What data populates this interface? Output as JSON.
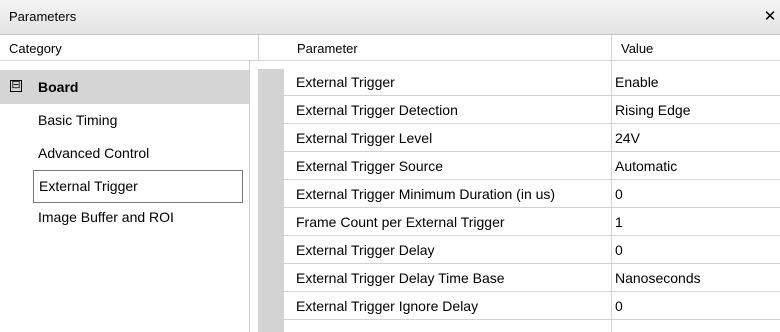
{
  "window": {
    "title": "Parameters",
    "close_glyph": "✕"
  },
  "headers": {
    "category": "Category",
    "parameter": "Parameter",
    "value": "Value"
  },
  "categories": {
    "board": {
      "label": "Board",
      "expander": "⊟"
    },
    "items": [
      "Basic Timing",
      "Advanced Control",
      "External Trigger",
      "Image Buffer and ROI"
    ],
    "selected": "External Trigger"
  },
  "params": [
    {
      "name": "External Trigger",
      "value": "Enable"
    },
    {
      "name": "External Trigger Detection",
      "value": "Rising Edge"
    },
    {
      "name": "External Trigger Level",
      "value": "24V"
    },
    {
      "name": "External Trigger Source",
      "value": "Automatic"
    },
    {
      "name": "External Trigger Minimum Duration (in us)",
      "value": "0"
    },
    {
      "name": "Frame Count per External Trigger",
      "value": "1"
    },
    {
      "name": "External Trigger Delay",
      "value": "0"
    },
    {
      "name": "External Trigger Delay Time Base",
      "value": "Nanoseconds"
    },
    {
      "name": "External Trigger Ignore Delay",
      "value": "0"
    }
  ]
}
